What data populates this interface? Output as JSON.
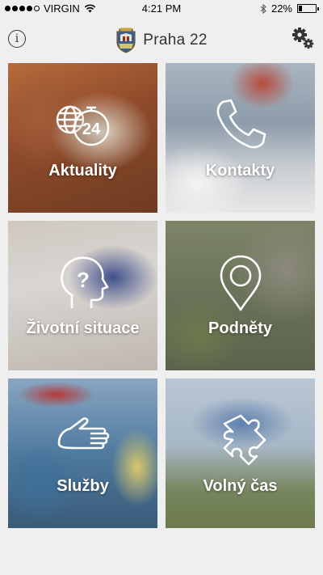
{
  "status_bar": {
    "carrier": "VIRGIN",
    "time": "4:21 PM",
    "battery": "22%",
    "battery_level": 0.22,
    "signal_dots_filled": 4,
    "signal_dots_total": 5,
    "icons": [
      "wifi-icon",
      "bluetooth-icon",
      "battery-icon"
    ]
  },
  "nav": {
    "title": "Praha 22",
    "info_icon": "info-icon",
    "crest_icon": "coat-of-arms-icon",
    "settings_icon": "gear-icon"
  },
  "tiles": [
    {
      "label": "Aktuality",
      "icon": "globe-24h-icon"
    },
    {
      "label": "Kontakty",
      "icon": "phone-icon"
    },
    {
      "label": "Životní situace",
      "icon": "head-question-icon"
    },
    {
      "label": "Podněty",
      "icon": "map-pin-icon"
    },
    {
      "label": "Služby",
      "icon": "hand-icon"
    },
    {
      "label": "Volný čas",
      "icon": "puzzle-icon"
    }
  ],
  "colors": {
    "background": "#efefef",
    "tile_text": "#ffffff",
    "nav_text": "#333333"
  }
}
